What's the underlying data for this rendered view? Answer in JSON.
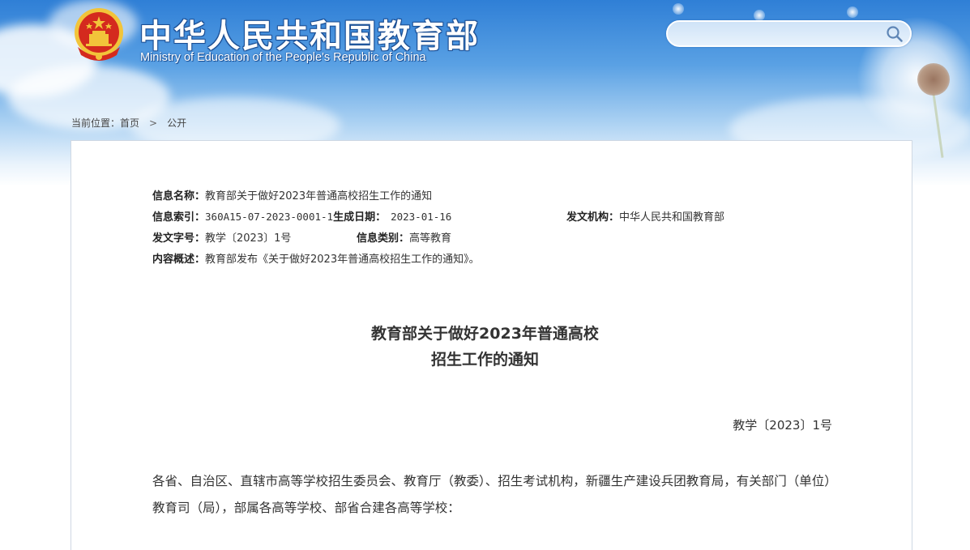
{
  "header": {
    "title": "中华人民共和国教育部",
    "subtitle": "Ministry of Education of the People's Republic of China",
    "search_placeholder": ""
  },
  "breadcrumb": {
    "prefix": "当前位置：",
    "home": "首页",
    "separator": ">",
    "current": "公开"
  },
  "meta": {
    "info_name_label": "信息名称：",
    "info_name_value": "教育部关于做好2023年普通高校招生工作的通知",
    "index_label": "信息索引：",
    "index_value": "360A15-07-2023-0001-1",
    "date_label": "生成日期：",
    "date_value": "2023-01-16",
    "issuer_label": "发文机构：",
    "issuer_value": "中华人民共和国教育部",
    "doc_no_label": "发文字号：",
    "doc_no_value": "教学〔2023〕1号",
    "category_label": "信息类别：",
    "category_value": "高等教育",
    "summary_label": "内容概述：",
    "summary_value": "教育部发布《关于做好2023年普通高校招生工作的通知》。"
  },
  "document": {
    "title_line1": "教育部关于做好2023年普通高校",
    "title_line2": "招生工作的通知",
    "number": "教学〔2023〕1号",
    "salutation": "各省、自治区、直辖市高等学校招生委员会、教育厅（教委）、招生考试机构，新疆生产建设兵团教育局，有关部门（单位）教育司（局），部属各高等学校、部省合建各高等学校："
  },
  "colors": {
    "sky_top": "#2f7fd6",
    "emblem_red": "#d42a1e",
    "emblem_gold": "#f2c43a"
  }
}
